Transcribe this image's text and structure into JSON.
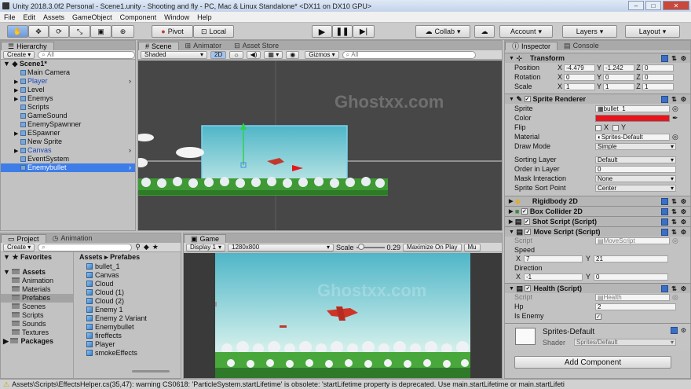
{
  "window": {
    "title": "Unity 2018.3.0f2 Personal - Scene1.unity - Shooting and fly - PC, Mac & Linux Standalone* <DX11 on DX10 GPU>",
    "controls": [
      "–",
      "□",
      "✕"
    ]
  },
  "menu": [
    "File",
    "Edit",
    "Assets",
    "GameObject",
    "Component",
    "Window",
    "Help"
  ],
  "toolbar": {
    "pivot": "Pivot",
    "local": "Local",
    "collab": "Collab",
    "account": "Account",
    "layers": "Layers",
    "layout": "Layout"
  },
  "hierarchy": {
    "tab": "Hierarchy",
    "create": "Create",
    "search": "All",
    "scene": "Scene1*",
    "items": [
      {
        "label": "Main Camera",
        "arrow": ""
      },
      {
        "label": "Player",
        "arrow": "▶",
        "more": "›"
      },
      {
        "label": "Level",
        "arrow": "▶"
      },
      {
        "label": "Enemys",
        "arrow": "▶"
      },
      {
        "label": "Scripts",
        "arrow": ""
      },
      {
        "label": "GameSound",
        "arrow": ""
      },
      {
        "label": "EnemySpawnner",
        "arrow": ""
      },
      {
        "label": "ESpawner",
        "arrow": "▶"
      },
      {
        "label": "New Sprite",
        "arrow": ""
      },
      {
        "label": "Canvas",
        "arrow": "▶",
        "more": "›"
      },
      {
        "label": "EventSystem",
        "arrow": ""
      },
      {
        "label": "Enemybullet",
        "arrow": "",
        "more": "›"
      }
    ]
  },
  "scene_view": {
    "tabs": [
      "Scene",
      "Animator",
      "Asset Store"
    ],
    "shading": "Shaded",
    "mode2d": "2D",
    "gizmos": "Gizmos",
    "search": "All"
  },
  "game_view": {
    "tab": "Game",
    "display": "Display 1",
    "resolution": "1280x800",
    "scale_label": "Scale",
    "scale_value": "0.29",
    "maximize": "Maximize On Play",
    "mute": "Mu"
  },
  "project": {
    "tabs": [
      "Project",
      "Animation"
    ],
    "create": "Create",
    "favorites": "Favorites",
    "assets": "Assets",
    "packages": "Packages",
    "folders": [
      "Animation",
      "Materials",
      "Prefabes",
      "Scenes",
      "Scripts",
      "Sounds",
      "Textures"
    ],
    "breadcrumb_root": "Assets",
    "breadcrumb_sep": "▸",
    "breadcrumb_leaf": "Prefabes",
    "files": [
      "bullet_1",
      "Canvas",
      "Cloud",
      "Cloud (1)",
      "Cloud (2)",
      "Enemy 1",
      "Enemy 2 Variant",
      "Enemybullet",
      "fireffects",
      "Player",
      "smokeEffects"
    ]
  },
  "inspector": {
    "tabs": [
      "Inspector",
      "Console"
    ],
    "transform": {
      "title": "Transform",
      "rows": [
        {
          "label": "Position",
          "x": "-4.479",
          "y": "-1.242",
          "z": "0"
        },
        {
          "label": "Rotation",
          "x": "0",
          "y": "0",
          "z": "0"
        },
        {
          "label": "Scale",
          "x": "1",
          "y": "1",
          "z": "1"
        }
      ]
    },
    "axis_labels": {
      "x": "X",
      "y": "Y",
      "z": "Z"
    },
    "sprite_renderer": {
      "title": "Sprite Renderer",
      "sprite_label": "Sprite",
      "sprite": "bullet_1",
      "color_label": "Color",
      "flip_label": "Flip",
      "material_label": "Material",
      "material": "Sprites-Default",
      "draw_mode_label": "Draw Mode",
      "draw_mode": "Simple",
      "sorting_layer_label": "Sorting Layer",
      "sorting_layer": "Default",
      "order_label": "Order in Layer",
      "order": "0",
      "mask_label": "Mask Interaction",
      "mask": "None",
      "sort_point_label": "Sprite Sort Point",
      "sort_point": "Center"
    },
    "components": [
      "Rigidbody 2D",
      "Box Collider 2D",
      "Shot Script (Script)",
      "Move Script (Script)"
    ],
    "move_script": {
      "script_label": "Script",
      "script": "MoveScript",
      "speed_label": "Speed",
      "speed_x": "7",
      "speed_y": "21",
      "direction_label": "Direction",
      "dir_x": "-1",
      "dir_y": "0"
    },
    "health": {
      "title": "Health (Script)",
      "script_label": "Script",
      "script": "Health",
      "hp_label": "Hp",
      "hp": "2",
      "enemy_label": "Is Enemy"
    },
    "material": {
      "name": "Sprites-Default",
      "shader_label": "Shader",
      "shader": "Sprites/Default"
    },
    "add_component": "Add Component"
  },
  "status": "Assets\\Scripts\\EffectsHelper.cs(35,47): warning CS0618: 'ParticleSystem.startLifetime' is obsolete: 'startLifetime property is deprecated. Use main.startLifetime or main.startLifeti",
  "watermark": "Ghostxx.com",
  "colors": {
    "accent": "#3e7de7",
    "color_field": "#e8141b",
    "sky_top": "#4fb6c8",
    "sky_bottom": "#cfeeea"
  }
}
